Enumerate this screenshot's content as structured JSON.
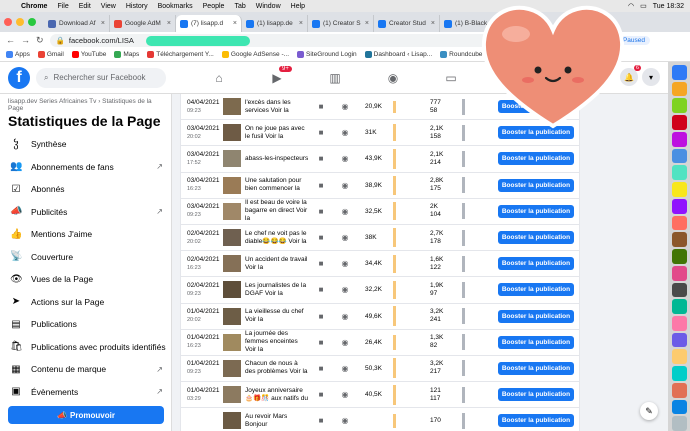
{
  "menubar": {
    "app": "Chrome",
    "items": [
      "File",
      "Edit",
      "View",
      "History",
      "Bookmarks",
      "People",
      "Tab",
      "Window",
      "Help"
    ],
    "clock": "Tue 18:32"
  },
  "tabs": [
    {
      "label": "Download Af",
      "color": "#4a67b0"
    },
    {
      "label": "Google AdM",
      "color": "#ea4335"
    },
    {
      "label": "(7) lisapp.d",
      "color": "#1877f2"
    },
    {
      "label": "(1) lisapp.de",
      "color": "#1877f2"
    },
    {
      "label": "(1) Creator S",
      "color": "#1877f2"
    },
    {
      "label": "Creator Stud",
      "color": "#1877f2"
    },
    {
      "label": "(1) B-Black",
      "color": "#1877f2"
    },
    {
      "label": "",
      "color": "#1877f2"
    }
  ],
  "address": {
    "url": "facebook.com/LISA",
    "paused": "Paused"
  },
  "bookmarks": [
    {
      "label": "Apps",
      "color": "#4285f4"
    },
    {
      "label": "Gmail",
      "color": "#ea4335"
    },
    {
      "label": "YouTube",
      "color": "#ff0000"
    },
    {
      "label": "Maps",
      "color": "#34a853"
    },
    {
      "label": "Téléchargement Y...",
      "color": "#e53935"
    },
    {
      "label": "Google AdSense -...",
      "color": "#fbbc04"
    },
    {
      "label": "SiteGround Login",
      "color": "#7a5cd0"
    },
    {
      "label": "Dashboard ‹ Lisap...",
      "color": "#21759b"
    },
    {
      "label": "Roundcube",
      "color": "#3a8fc2"
    }
  ],
  "fb": {
    "logo": "f",
    "search_placeholder": "Rechercher sur Facebook",
    "watch_badge": "9+",
    "notif_badge": "6"
  },
  "sidebar": {
    "breadcrumb": "lisapp.dev Series Africaines Tv › Statistiques de la Page",
    "title": "Statistiques de la Page",
    "items": [
      {
        "label": "Synthèse",
        "icon": "ჴ",
        "ext": false
      },
      {
        "label": "Abonnements de fans",
        "icon": "👥",
        "ext": true
      },
      {
        "label": "Abonnés",
        "icon": "☑",
        "ext": false
      },
      {
        "label": "Publicités",
        "icon": "📣",
        "ext": true
      },
      {
        "label": "Mentions J'aime",
        "icon": "👍",
        "ext": false
      },
      {
        "label": "Couverture",
        "icon": "📡",
        "ext": false
      },
      {
        "label": "Vues de la Page",
        "icon": "👁",
        "ext": false
      },
      {
        "label": "Actions sur la Page",
        "icon": "➤",
        "ext": false
      },
      {
        "label": "Publications",
        "icon": "▤",
        "ext": false
      },
      {
        "label": "Publications avec produits identifiés",
        "icon": "🛍",
        "ext": false
      },
      {
        "label": "Contenu de marque",
        "icon": "▦",
        "ext": true
      },
      {
        "label": "Évènements",
        "icon": "▣",
        "ext": true
      }
    ],
    "promote": "Promouvoir"
  },
  "posts": [
    {
      "date": "04/04/2021",
      "time": "09:23",
      "text": "l'excès dans les services Voir la",
      "reach": "20,9K",
      "reach_frac": 0.5,
      "eng1": "777",
      "eng2": "58",
      "boost": "Booster la publication"
    },
    {
      "date": "03/04/2021",
      "time": "20:02",
      "text": "On ne joue pas avec le fusil Voir la",
      "reach": "31K",
      "reach_frac": 0.8,
      "eng1": "2,1K",
      "eng2": "158",
      "boost": "Booster la publication"
    },
    {
      "date": "03/04/2021",
      "time": "17:52",
      "text": "abass-les-inspecteurs",
      "reach": "43,9K",
      "reach_frac": 1.0,
      "eng1": "2,1K",
      "eng2": "214",
      "boost": "Booster la publication"
    },
    {
      "date": "03/04/2021",
      "time": "16:23",
      "text": "Une salutation pour bien commencer la",
      "reach": "38,9K",
      "reach_frac": 0.95,
      "eng1": "2,8K",
      "eng2": "175",
      "boost": "Booster la publication"
    },
    {
      "date": "03/04/2021",
      "time": "09:23",
      "text": "Il est beau de voire la bagarre en direct Voir la",
      "reach": "32,5K",
      "reach_frac": 0.85,
      "eng1": "2K",
      "eng2": "104",
      "boost": "Booster la publication"
    },
    {
      "date": "02/04/2021",
      "time": "20:02",
      "text": "Le chef ne voit pas le diable😂😂😂 Voir la",
      "reach": "38K",
      "reach_frac": 0.95,
      "eng1": "2,7K",
      "eng2": "178",
      "boost": "Booster la publication"
    },
    {
      "date": "02/04/2021",
      "time": "16:23",
      "text": "Un accident de travail Voir la",
      "reach": "34,4K",
      "reach_frac": 0.88,
      "eng1": "1,6K",
      "eng2": "122",
      "boost": "Booster la publication"
    },
    {
      "date": "02/04/2021",
      "time": "09:23",
      "text": "Les journalistes de la DGAF Voir la",
      "reach": "32,2K",
      "reach_frac": 0.85,
      "eng1": "1,9K",
      "eng2": "97",
      "boost": "Booster la publication"
    },
    {
      "date": "01/04/2021",
      "time": "20:02",
      "text": "La vieillesse du chef Voir la",
      "reach": "49,6K",
      "reach_frac": 1.0,
      "eng1": "3,2K",
      "eng2": "241",
      "boost": "Booster la publication"
    },
    {
      "date": "01/04/2021",
      "time": "16:23",
      "text": "La journée des femmes enceintes Voir la",
      "reach": "26,4K",
      "reach_frac": 0.7,
      "eng1": "1,3K",
      "eng2": "82",
      "boost": "Booster la publication"
    },
    {
      "date": "01/04/2021",
      "time": "09:23",
      "text": "Chacun de nous à des problèmes Voir la",
      "reach": "50,3K",
      "reach_frac": 1.0,
      "eng1": "3,2K",
      "eng2": "217",
      "boost": "Booster la publication"
    },
    {
      "date": "01/04/2021",
      "time": "03:29",
      "text": "Joyeux anniversaire 🎂🎁🎊 aux natifs du",
      "reach": "40,5K",
      "reach_frac": 1.0,
      "eng1": "121",
      "eng2": "117",
      "boost": "Booster la publication"
    },
    {
      "date": "",
      "time": "",
      "text": "Au revoir Mars Bonjour",
      "reach": "",
      "reach_frac": 0.6,
      "eng1": "170",
      "eng2": "",
      "boost": "Booster la publication"
    }
  ]
}
